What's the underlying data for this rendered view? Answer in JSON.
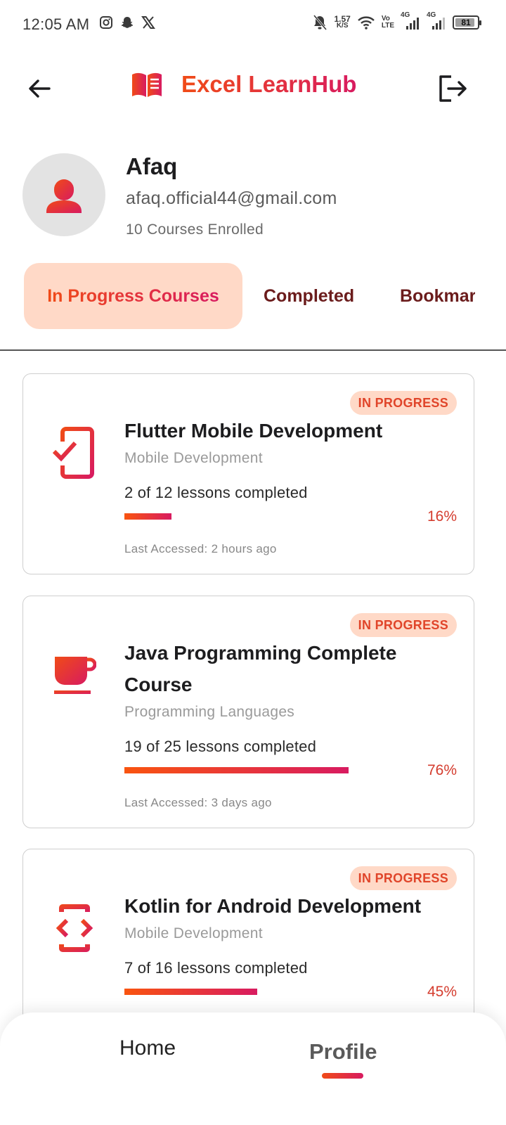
{
  "status_bar": {
    "time": "12:05 AM",
    "net_speed_value": "1.57",
    "net_speed_unit": "K/S",
    "volte_top": "Vo",
    "volte_bottom": "LTE",
    "net1": "4G",
    "net2": "4G",
    "battery": "81"
  },
  "header": {
    "title": "Excel LearnHub",
    "logo_icon": "book-icon",
    "back_icon": "arrow-back-icon",
    "logout_icon": "logout-icon"
  },
  "profile": {
    "name": "Afaq",
    "email": "afaq.official44@gmail.com",
    "courses_enrolled": "10 Courses Enrolled"
  },
  "tabs": [
    {
      "label": "In Progress Courses",
      "active": true
    },
    {
      "label": "Completed",
      "active": false
    },
    {
      "label": "Bookmarks",
      "active": false
    }
  ],
  "courses": [
    {
      "badge": "IN PROGRESS",
      "icon": "mobile-check-icon",
      "title": "Flutter Mobile Development",
      "category": "Mobile Development",
      "lessons": "2 of 12 lessons completed",
      "progress": 0.16,
      "percent": "16%",
      "last_accessed": "Last Accessed: 2 hours ago"
    },
    {
      "badge": "IN PROGRESS",
      "icon": "coffee-cup-icon",
      "title": "Java Programming Complete Course",
      "category": "Programming Languages",
      "lessons": "19 of 25 lessons completed",
      "progress": 0.76,
      "percent": "76%",
      "last_accessed": "Last Accessed: 3 days ago"
    },
    {
      "badge": "IN PROGRESS",
      "icon": "code-brackets-icon",
      "title": "Kotlin for Android Development",
      "category": "Mobile Development",
      "lessons": "7 of 16 lessons completed",
      "progress": 0.45,
      "percent": "45%",
      "last_accessed": ""
    }
  ],
  "bottom_nav": {
    "home": "Home",
    "profile": "Profile",
    "active": "profile"
  },
  "colors": {
    "accent_start": "#f04b17",
    "accent_end": "#d81b60",
    "badge_bg": "#ffd9c7"
  }
}
